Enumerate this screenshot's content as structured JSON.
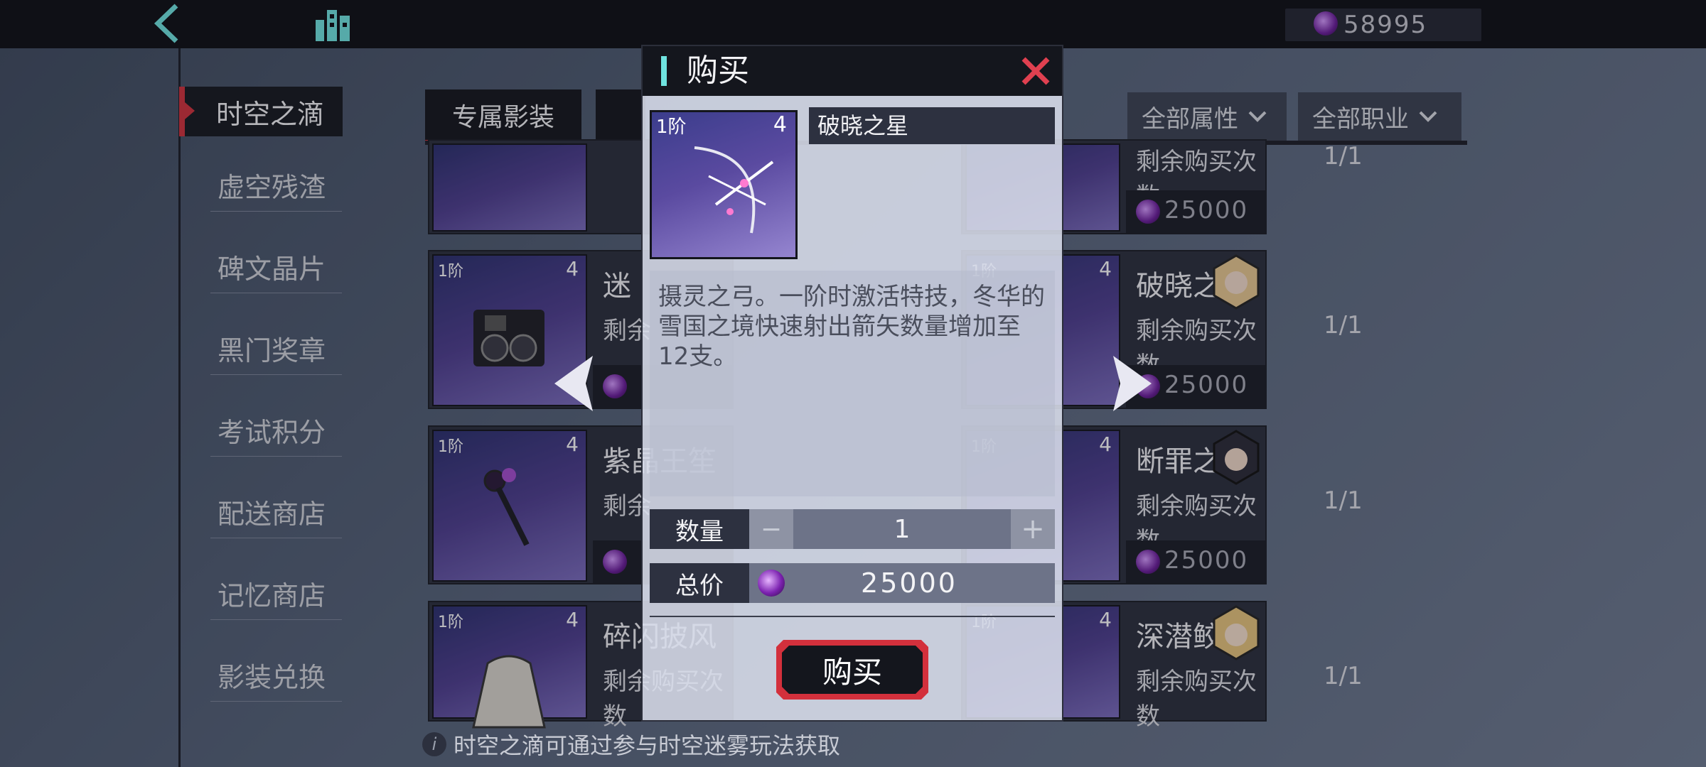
{
  "currency": {
    "icon": "gem-icon",
    "value": "58995"
  },
  "sidebar": {
    "items": [
      {
        "label": "时空之滴",
        "active": true
      },
      {
        "label": "虚空残渣"
      },
      {
        "label": "碑文晶片"
      },
      {
        "label": "黑门奖章"
      },
      {
        "label": "考试积分"
      },
      {
        "label": "配送商店"
      },
      {
        "label": "记忆商店"
      },
      {
        "label": "影装兑换"
      }
    ]
  },
  "tabs": {
    "active": "专属影装"
  },
  "filters": {
    "attribute": "全部属性",
    "profession": "全部职业"
  },
  "grid": {
    "left": [
      {
        "name": "迷",
        "remain_label": "剩余",
        "remain_value": "",
        "price": ""
      },
      {
        "name": "紫晶王笙",
        "remain_label": "剩余",
        "remain_value": "",
        "price": ""
      },
      {
        "name": "碎闪披风",
        "remain_label": "剩余购买次数",
        "remain_value": "",
        "price": ""
      }
    ],
    "right": [
      {
        "name": "",
        "remain_label": "剩余购买次数",
        "remain_value": "1/1",
        "price": "25000"
      },
      {
        "name": "破晓之星",
        "remain_label": "剩余购买次数",
        "remain_value": "1/1",
        "price": "25000"
      },
      {
        "name": "断罪之枷",
        "remain_label": "剩余购买次数",
        "remain_value": "1/1",
        "price": "25000"
      },
      {
        "name": "深潜鲛绡",
        "remain_label": "剩余购买次数",
        "remain_value": "1/1",
        "price": ""
      }
    ],
    "tier_label": "1阶",
    "count_label": "4"
  },
  "info": {
    "text": "时空之滴可通过参与时空迷雾玩法获取"
  },
  "modal": {
    "title": "购买",
    "item": {
      "name": "破晓之星",
      "tier": "1阶",
      "count": "4"
    },
    "description": "摄灵之弓。一阶时激活特技，冬华的雪国之境快速射出箭矢数量增加至12支。",
    "quantity": {
      "label": "数量",
      "value": "1",
      "minus": "−",
      "plus": "+"
    },
    "total": {
      "label": "总价",
      "value": "25000"
    },
    "buy_label": "购买"
  }
}
